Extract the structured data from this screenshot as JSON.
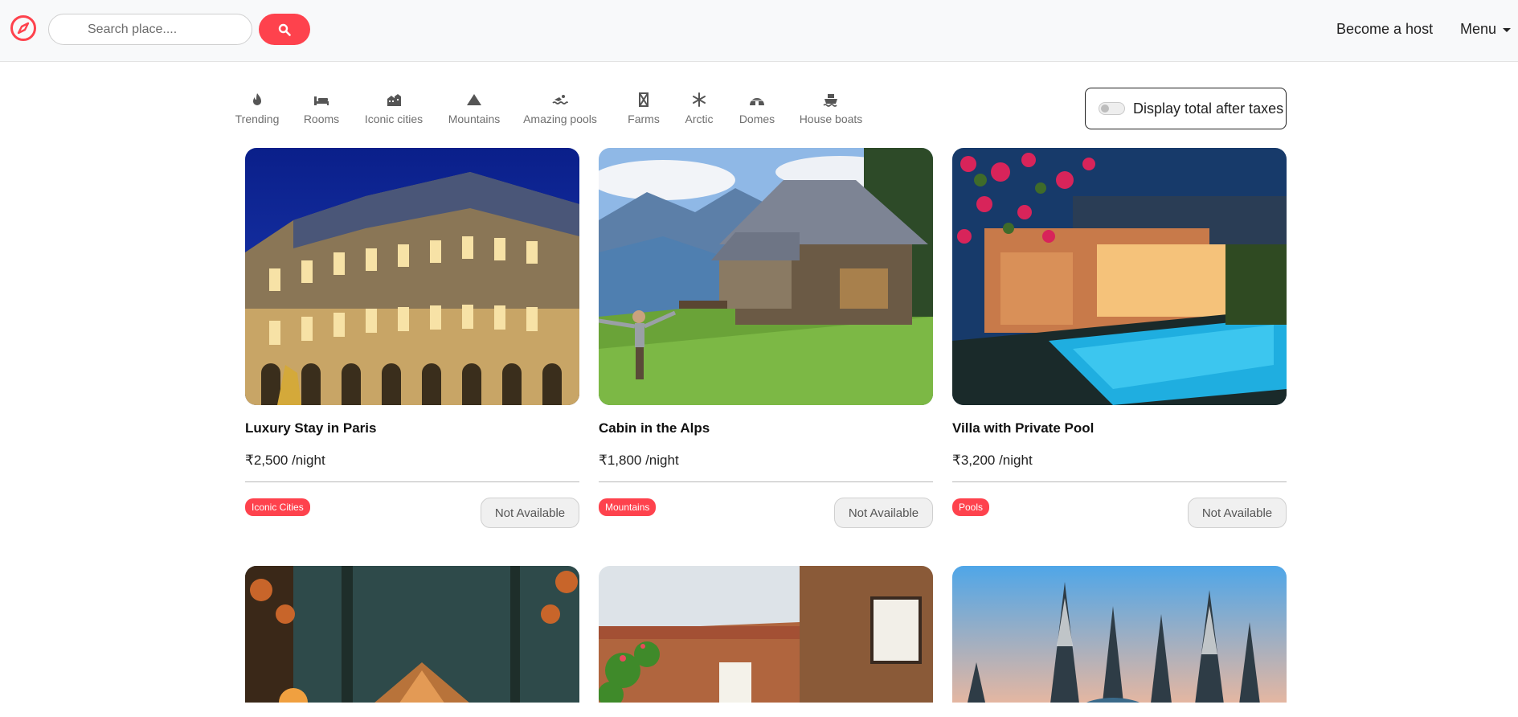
{
  "navbar": {
    "search_placeholder": "Search place....",
    "become_host": "Become a host",
    "menu_label": "Menu",
    "brand_color": "#fe424d",
    "logo_icon": "compass-icon",
    "search_icon": "search-icon"
  },
  "filters": [
    {
      "label": "Trending",
      "icon": "fire-icon"
    },
    {
      "label": "Rooms",
      "icon": "bed-icon"
    },
    {
      "label": "Iconic cities",
      "icon": "city-icon"
    },
    {
      "label": "Mountains",
      "icon": "mountain-icon"
    },
    {
      "label": "Amazing pools",
      "icon": "swimmer-icon"
    },
    {
      "label": "Farms",
      "icon": "farm-icon"
    },
    {
      "label": "Arctic",
      "icon": "snowflake-icon"
    },
    {
      "label": "Domes",
      "icon": "igloo-icon"
    },
    {
      "label": "House boats",
      "icon": "ship-icon"
    }
  ],
  "tax_toggle": {
    "label": "Display total after taxes",
    "checked": false
  },
  "listings": [
    {
      "title": "Luxury Stay in Paris",
      "price": "₹2,500 /night",
      "tag": "Iconic Cities",
      "status": "Not Available",
      "image": "paris-hotel-night"
    },
    {
      "title": "Cabin in the Alps",
      "price": "₹1,800 /night",
      "tag": "Mountains",
      "status": "Not Available",
      "image": "alpine-cabin"
    },
    {
      "title": "Villa with Private Pool",
      "price": "₹3,200 /night",
      "tag": "Pools",
      "status": "Not Available",
      "image": "villa-pool-dusk"
    },
    {
      "image": "forest-tent-camp"
    },
    {
      "image": "brick-courtyard-house"
    },
    {
      "image": "snowy-pine-dome"
    }
  ]
}
